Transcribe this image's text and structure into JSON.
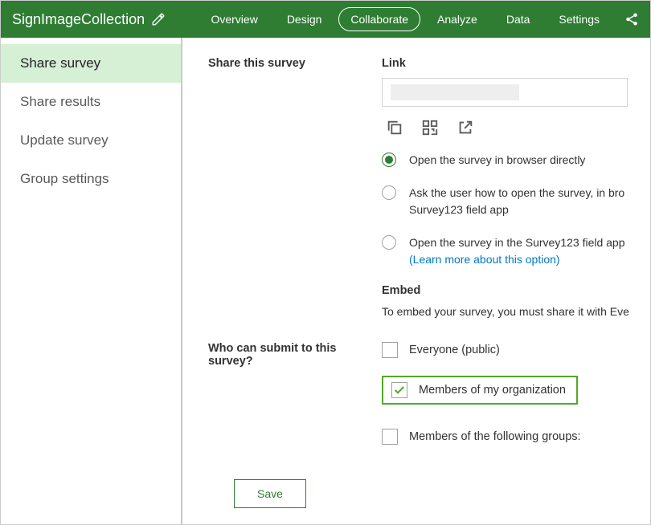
{
  "header": {
    "title": "SignImageCollection",
    "tabs": [
      {
        "label": "Overview",
        "active": false
      },
      {
        "label": "Design",
        "active": false
      },
      {
        "label": "Collaborate",
        "active": true
      },
      {
        "label": "Analyze",
        "active": false
      },
      {
        "label": "Data",
        "active": false
      },
      {
        "label": "Settings",
        "active": false
      }
    ]
  },
  "sidebar": {
    "items": [
      {
        "label": "Share survey",
        "selected": true
      },
      {
        "label": "Share results",
        "selected": false
      },
      {
        "label": "Update survey",
        "selected": false
      },
      {
        "label": "Group settings",
        "selected": false
      }
    ]
  },
  "share": {
    "section_label": "Share this survey",
    "link_label": "Link",
    "radios": {
      "browser": "Open the survey in browser directly",
      "ask_prefix": "Ask the user how to open the survey, in bro",
      "ask_line2": "Survey123 field app",
      "field_app": "Open the survey in the Survey123 field app",
      "learn_more": "(Learn more about this option)"
    },
    "embed_label": "Embed",
    "embed_text": "To embed your survey, you must share it with Eve"
  },
  "submit": {
    "section_label": "Who can submit to this survey?",
    "options": {
      "everyone": "Everyone (public)",
      "org": "Members of my organization",
      "groups": "Members of the following groups:"
    }
  },
  "buttons": {
    "save": "Save"
  }
}
